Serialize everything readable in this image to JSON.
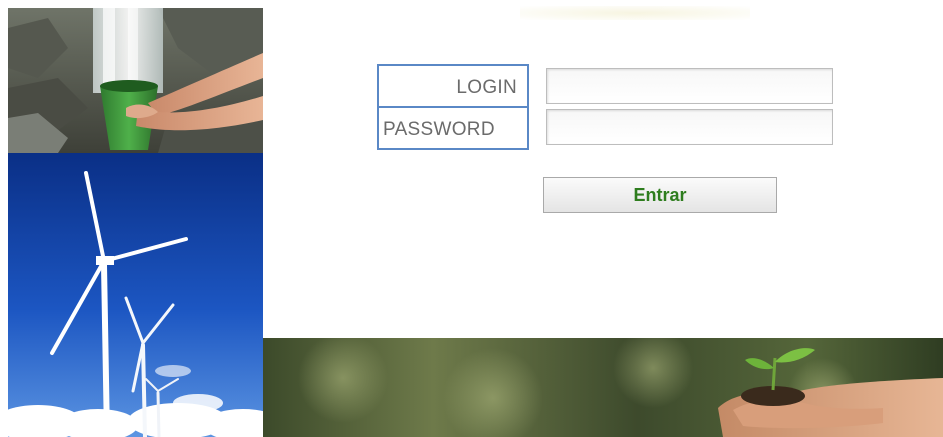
{
  "form": {
    "login_label": "LOGIN",
    "password_label": "PASSWORD",
    "login_value": "",
    "password_value": "",
    "submit_label": "Entrar"
  },
  "colors": {
    "label_border": "#5a88c6",
    "button_text": "#2e7d1e",
    "label_text": "#6b6b6b"
  },
  "images": [
    "waterfall-bucket-photo",
    "wind-turbines-photo",
    "seedling-in-hands-banner"
  ]
}
